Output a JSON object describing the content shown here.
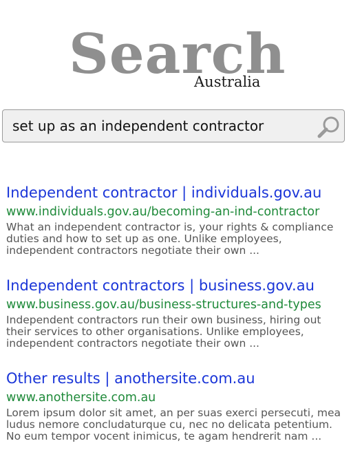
{
  "logo": {
    "main": "Search",
    "sub": "Australia"
  },
  "search": {
    "query": "set up as an independent contractor",
    "icon": "magnifier-icon"
  },
  "results": [
    {
      "title": "Independent contractor | individuals.gov.au",
      "url": "www.individuals.gov.au/becoming-an-ind-contractor",
      "snippet": "What an independent contractor is, your rights & compliance duties and how to set up as one. Unlike employees, independent contractors negotiate their own ..."
    },
    {
      "title": "Independent contractors | business.gov.au",
      "url": "www.business.gov.au/business-structures-and-types",
      "snippet": "Independent contractors run their own business, hiring out their services to other organisations. Unlike employees, independent contractors negotiate their own ..."
    },
    {
      "title": "Other results | anothersite.com.au",
      "url": "www.anothersite.com.au",
      "snippet": "Lorem ipsum dolor sit amet, an per suas exerci persecuti, mea ludus nemore concludaturque cu, nec no delicata petentium. No eum tempor vocent inimicus, te agam hendrerit nam ..."
    }
  ],
  "colors": {
    "title_link": "#1a35d8",
    "url": "#1f8a3a",
    "snippet": "#555555",
    "logo": "#8f8f8f"
  }
}
